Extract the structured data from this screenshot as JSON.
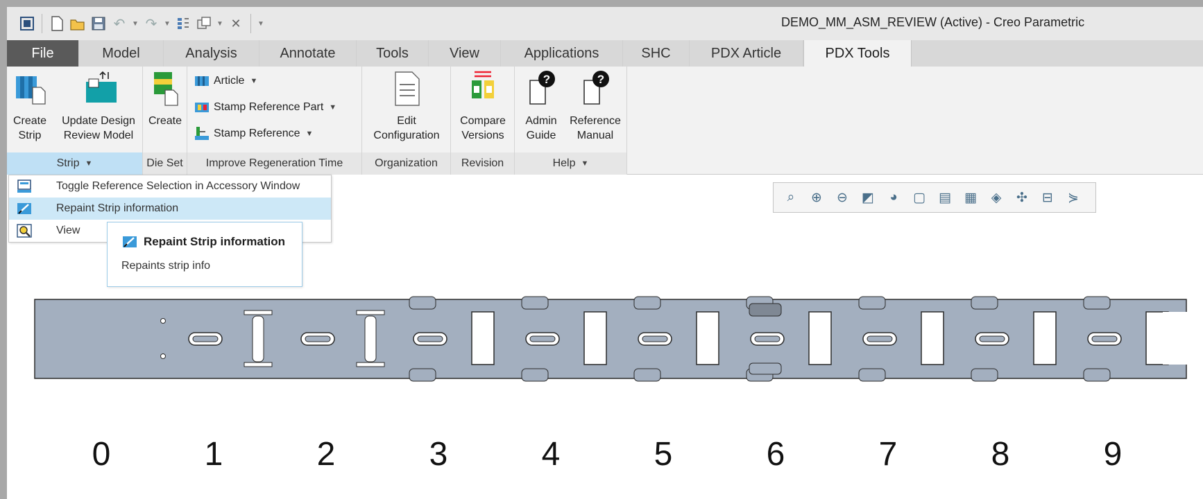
{
  "window": {
    "title": "DEMO_MM_ASM_REVIEW (Active) - Creo Parametric"
  },
  "tabs": [
    "File",
    "Model",
    "Analysis",
    "Annotate",
    "Tools",
    "View",
    "Applications",
    "SHC",
    "PDX Article",
    "PDX Tools"
  ],
  "active_tab": "PDX Tools",
  "ribbon": {
    "strip_group": {
      "label": "Strip",
      "create_strip": [
        "Create",
        "Strip"
      ],
      "update_design": [
        "Update Design",
        "Review Model"
      ]
    },
    "die_set_group": {
      "label": "Die Set",
      "create": "Create"
    },
    "improve_group": {
      "label": "Improve Regeneration Time",
      "article": "Article",
      "stamp_reference_part": "Stamp Reference Part",
      "stamp_reference": "Stamp Reference"
    },
    "organization_group": {
      "label": "Organization",
      "edit_configuration": [
        "Edit",
        "Configuration"
      ]
    },
    "revision_group": {
      "label": "Revision",
      "compare_versions": [
        "Compare",
        "Versions"
      ]
    },
    "help_group": {
      "label": "Help",
      "admin_guide": [
        "Admin",
        "Guide"
      ],
      "reference_manual": [
        "Reference",
        "Manual"
      ]
    }
  },
  "strip_menu": {
    "items": [
      "Toggle Reference Selection in Accessory Window",
      "Repaint Strip information",
      "View"
    ]
  },
  "tooltip": {
    "title": "Repaint Strip information",
    "description": "Repaints strip info"
  },
  "stations": [
    "0",
    "1",
    "2",
    "3",
    "4",
    "5",
    "6",
    "7",
    "8",
    "9"
  ],
  "colors": {
    "strip_fill": "#a3afbf",
    "strip_stroke": "#2b2b2b",
    "highlight": "#cde8f7",
    "file_tab": "#5a5a5a"
  }
}
